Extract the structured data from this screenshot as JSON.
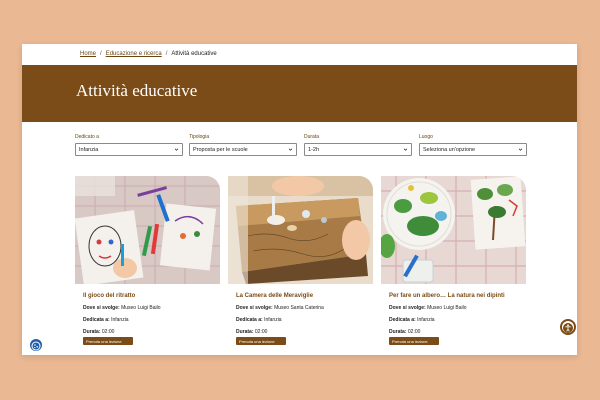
{
  "breadcrumb": {
    "home": "Home",
    "section": "Educazione e ricerca",
    "current": "Attività educative"
  },
  "page_title": "Attività educative",
  "filters": [
    {
      "label": "Dedicato a",
      "value": "Infanzia"
    },
    {
      "label": "Tipologia",
      "value": "Proposta per le scuole"
    },
    {
      "label": "Durata",
      "value": "1-2h"
    },
    {
      "label": "Luogo",
      "value": "Seleziona un'opzione"
    }
  ],
  "meta_labels": {
    "place": "Dove si svolge:",
    "audience": "Dedicata a:",
    "duration": "Durata:"
  },
  "cards": [
    {
      "title": "Il gioco del ritratto",
      "place": "Museo Luigi Bailo",
      "audience": "Infanzia",
      "duration": "02:00",
      "button": "Prenota una lezione"
    },
    {
      "title": "La Camera delle Meraviglie",
      "place": "Museo Santa Caterina",
      "audience": "Infanzia",
      "duration": "02:00",
      "button": "Prenota una lezione"
    },
    {
      "title": "Per fare un albero… La natura nei dipinti",
      "place": "Museo Luigi Bailo",
      "audience": "Infanzia",
      "duration": "02:00",
      "button": "Prenota una lezione"
    }
  ],
  "colors": {
    "brand": "#7b4c17",
    "background": "#eab892"
  },
  "icons": {
    "select": "chevron-down-icon",
    "cookie": "cookie-icon",
    "accessibility": "accessibility-icon"
  }
}
